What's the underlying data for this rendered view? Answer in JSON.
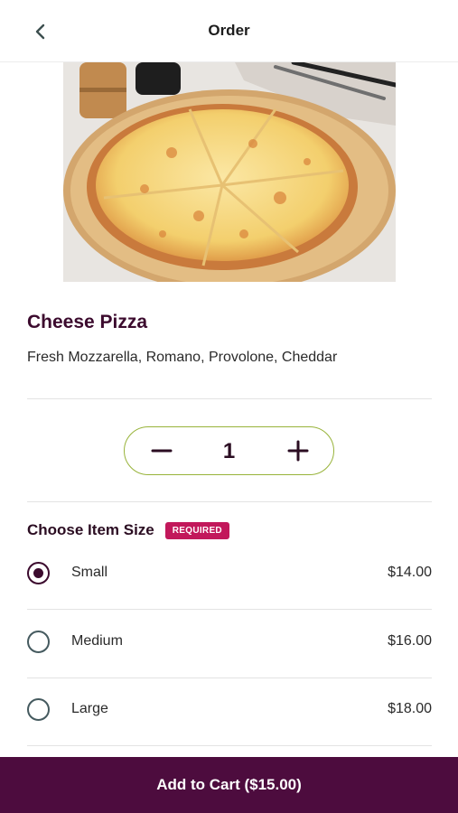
{
  "header": {
    "title": "Order",
    "back_icon": "chevron-left-icon"
  },
  "product": {
    "image": "cheese-pizza-photo",
    "title": "Cheese Pizza",
    "description": "Fresh Mozzarella, Romano, Provolone, Cheddar"
  },
  "quantity": {
    "value": "1",
    "minus_icon": "minus-icon",
    "plus_icon": "plus-icon"
  },
  "size_section": {
    "title": "Choose Item Size",
    "badge": "REQUIRED",
    "options": [
      {
        "label": "Small",
        "price": "$14.00",
        "selected": true
      },
      {
        "label": "Medium",
        "price": "$16.00",
        "selected": false
      },
      {
        "label": "Large",
        "price": "$18.00",
        "selected": false
      }
    ]
  },
  "cart": {
    "label": "Add to Cart ($15.00)"
  },
  "colors": {
    "brand": "#4d0c3e",
    "accent_border": "#98b33a",
    "required": "#c2185b"
  }
}
